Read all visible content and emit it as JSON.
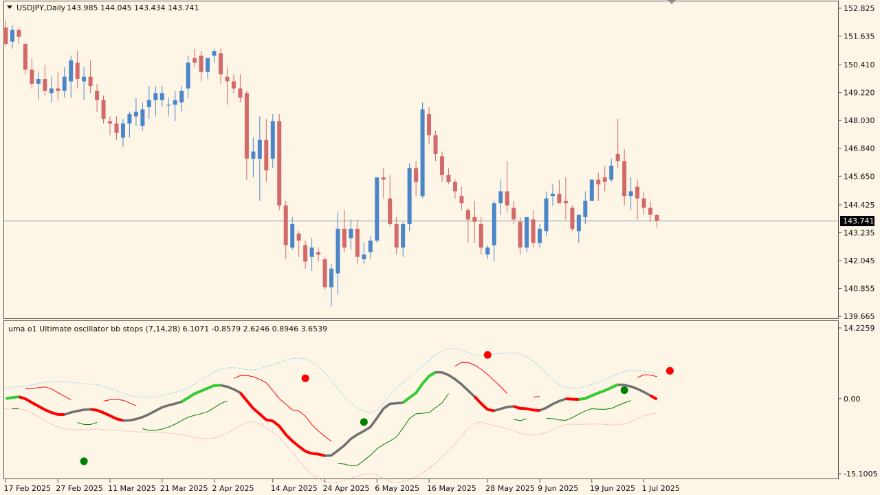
{
  "colors": {
    "background": "#fdf5e6",
    "bull_candle": "#4a86c8",
    "bear_candle": "#d26a6a",
    "axis": "#555555",
    "current_price_line": "#8fa6b8",
    "osc_line": "#707070",
    "osc_up": "#32cd32",
    "osc_down": "#ff0000",
    "stop_up": "#008000",
    "stop_down": "#ff0000",
    "upper_band": "#87ceeb",
    "lower_band": "#f0a0a0"
  },
  "chart_data": [
    {
      "type": "candlestick",
      "title": "USDJPY,Daily",
      "ohlc_header": "143.985 144.045 143.434 143.741",
      "ylim": [
        139.665,
        152.825
      ],
      "y_ticks": [
        "152.825",
        "151.635",
        "150.410",
        "149.220",
        "148.030",
        "146.840",
        "145.650",
        "144.425",
        "143.235",
        "142.045",
        "140.855",
        "139.665"
      ],
      "current_price": "143.741",
      "x_tick_labels": [
        "17 Feb 2025",
        "27 Feb 2025",
        "11 Mar 2025",
        "21 Mar 2025",
        "2 Apr 2025",
        "14 Apr 2025",
        "24 Apr 2025",
        "6 May 2025",
        "16 May 2025",
        "28 May 2025",
        "9 Jun 2025",
        "19 Jun 2025",
        "1 Jul 2025"
      ],
      "candles": [
        [
          152.0,
          152.3,
          151.2,
          151.3
        ],
        [
          151.4,
          152.1,
          151.1,
          151.9
        ],
        [
          151.9,
          152.0,
          151.3,
          151.6
        ],
        [
          151.3,
          151.3,
          150.0,
          150.2
        ],
        [
          150.2,
          150.7,
          149.4,
          149.6
        ],
        [
          149.6,
          150.1,
          148.9,
          149.8
        ],
        [
          149.8,
          150.4,
          149.1,
          149.3
        ],
        [
          149.2,
          149.9,
          148.8,
          149.4
        ],
        [
          149.4,
          150.1,
          148.9,
          149.3
        ],
        [
          149.3,
          150.3,
          149.0,
          149.9
        ],
        [
          149.7,
          150.8,
          149.0,
          150.6
        ],
        [
          150.5,
          151.0,
          149.4,
          149.8
        ],
        [
          149.7,
          150.3,
          148.9,
          149.9
        ],
        [
          149.9,
          150.6,
          149.2,
          149.5
        ],
        [
          149.3,
          149.6,
          148.4,
          148.9
        ],
        [
          148.9,
          149.1,
          147.9,
          148.1
        ],
        [
          148.0,
          148.2,
          147.4,
          147.9
        ],
        [
          147.9,
          148.2,
          147.2,
          147.5
        ],
        [
          147.3,
          148.1,
          146.9,
          147.9
        ],
        [
          147.9,
          148.4,
          147.3,
          148.3
        ],
        [
          148.2,
          149.0,
          147.8,
          148.4
        ],
        [
          147.8,
          148.8,
          147.6,
          148.5
        ],
        [
          148.6,
          149.5,
          148.1,
          148.9
        ],
        [
          148.9,
          149.5,
          148.2,
          149.2
        ],
        [
          148.9,
          149.5,
          148.6,
          149.2
        ],
        [
          148.7,
          149.0,
          148.2,
          148.7
        ],
        [
          148.7,
          149.3,
          148.0,
          148.9
        ],
        [
          148.8,
          149.5,
          148.4,
          149.3
        ],
        [
          149.4,
          150.8,
          149.0,
          150.5
        ],
        [
          150.7,
          151.1,
          150.3,
          150.5
        ],
        [
          150.8,
          151.0,
          149.7,
          150.1
        ],
        [
          150.1,
          150.6,
          149.8,
          150.7
        ],
        [
          150.8,
          151.1,
          150.5,
          151.0
        ],
        [
          150.9,
          151.1,
          149.6,
          150.0
        ],
        [
          149.9,
          150.3,
          148.7,
          149.7
        ],
        [
          149.7,
          150.0,
          149.2,
          149.4
        ],
        [
          149.4,
          150.0,
          148.8,
          149.0
        ],
        [
          149.2,
          149.3,
          145.5,
          146.4
        ],
        [
          146.4,
          147.3,
          145.6,
          146.7
        ],
        [
          146.4,
          148.2,
          144.6,
          147.2
        ],
        [
          147.2,
          148.1,
          145.4,
          145.9
        ],
        [
          146.4,
          148.3,
          146.0,
          148.0
        ],
        [
          148.0,
          148.3,
          144.2,
          144.4
        ],
        [
          144.4,
          144.6,
          142.1,
          142.7
        ],
        [
          142.6,
          143.9,
          142.5,
          143.6
        ],
        [
          143.2,
          143.3,
          142.2,
          142.9
        ],
        [
          142.7,
          142.9,
          141.7,
          142.0
        ],
        [
          142.2,
          143.0,
          141.6,
          142.6
        ],
        [
          142.4,
          142.6,
          142.0,
          142.3
        ],
        [
          142.1,
          142.2,
          140.8,
          140.9
        ],
        [
          140.9,
          141.9,
          140.1,
          141.7
        ],
        [
          141.5,
          144.1,
          140.6,
          143.4
        ],
        [
          143.4,
          144.2,
          142.4,
          142.6
        ],
        [
          143.0,
          143.8,
          142.5,
          143.4
        ],
        [
          143.4,
          143.8,
          141.9,
          142.2
        ],
        [
          142.1,
          142.8,
          141.9,
          142.3
        ],
        [
          142.4,
          143.1,
          142.1,
          142.9
        ],
        [
          142.9,
          145.6,
          142.8,
          145.6
        ],
        [
          145.6,
          146.0,
          144.7,
          145.5
        ],
        [
          144.7,
          145.7,
          143.5,
          143.6
        ],
        [
          143.6,
          143.9,
          142.3,
          142.6
        ],
        [
          142.6,
          143.7,
          142.2,
          143.6
        ],
        [
          143.6,
          146.2,
          143.3,
          146.0
        ],
        [
          146.0,
          146.3,
          144.8,
          145.4
        ],
        [
          144.8,
          148.8,
          144.7,
          148.5
        ],
        [
          148.3,
          148.6,
          147.0,
          147.4
        ],
        [
          147.4,
          147.6,
          146.3,
          146.6
        ],
        [
          146.5,
          146.7,
          145.4,
          145.7
        ],
        [
          145.7,
          146.0,
          145.3,
          145.4
        ],
        [
          145.4,
          145.5,
          144.7,
          145.0
        ],
        [
          144.8,
          145.2,
          144.2,
          144.5
        ],
        [
          144.2,
          144.3,
          142.8,
          143.8
        ],
        [
          143.9,
          144.6,
          142.8,
          143.7
        ],
        [
          143.6,
          143.9,
          142.3,
          142.6
        ],
        [
          142.3,
          142.7,
          142.1,
          142.6
        ],
        [
          142.7,
          144.6,
          142.0,
          144.5
        ],
        [
          144.5,
          145.5,
          144.0,
          145.0
        ],
        [
          145.0,
          146.3,
          144.1,
          144.4
        ],
        [
          144.3,
          144.6,
          143.6,
          143.8
        ],
        [
          143.7,
          143.9,
          142.3,
          142.6
        ],
        [
          142.6,
          143.9,
          142.4,
          143.9
        ],
        [
          143.8,
          144.2,
          142.6,
          142.8
        ],
        [
          142.8,
          143.6,
          142.6,
          143.4
        ],
        [
          143.3,
          145.0,
          143.1,
          144.7
        ],
        [
          144.8,
          145.3,
          144.4,
          144.9
        ],
        [
          144.9,
          145.5,
          144.5,
          144.5
        ],
        [
          144.6,
          145.6,
          143.8,
          144.5
        ],
        [
          144.3,
          144.4,
          143.3,
          143.4
        ],
        [
          143.3,
          144.0,
          142.8,
          144.0
        ],
        [
          143.9,
          145.0,
          143.6,
          144.6
        ],
        [
          144.6,
          145.5,
          144.6,
          145.5
        ],
        [
          145.5,
          145.8,
          144.6,
          145.3
        ],
        [
          145.6,
          146.1,
          145.0,
          145.4
        ],
        [
          145.5,
          146.4,
          145.4,
          146.1
        ],
        [
          146.6,
          148.1,
          146.0,
          146.3
        ],
        [
          146.3,
          146.8,
          144.4,
          144.8
        ],
        [
          144.8,
          145.6,
          144.2,
          145.0
        ],
        [
          145.2,
          145.5,
          143.8,
          144.7
        ],
        [
          144.7,
          145.0,
          144.0,
          144.3
        ],
        [
          144.3,
          144.6,
          143.7,
          144.0
        ],
        [
          143.985,
          144.045,
          143.434,
          143.741
        ]
      ]
    },
    {
      "type": "line",
      "title": "uma o1 Ultimate oscillator bb stops (7,14,28) 6.1071 -0.8579 2.6246 0.8946 3.6539",
      "ylim": [
        -15.1005,
        14.2259
      ],
      "y_ticks": [
        "14.2259",
        "0.00",
        "-15.1005"
      ],
      "markers": [
        {
          "i": 12,
          "value": -12.6,
          "kind": "buy"
        },
        {
          "i": 46,
          "value": 4.1,
          "kind": "sell"
        },
        {
          "i": 55,
          "value": -4.7,
          "kind": "buy"
        },
        {
          "i": 74,
          "value": 8.8,
          "kind": "sell"
        },
        {
          "i": 95,
          "value": 1.7,
          "kind": "buy"
        },
        {
          "i": 102,
          "value": 5.6,
          "kind": "sell"
        }
      ]
    }
  ]
}
